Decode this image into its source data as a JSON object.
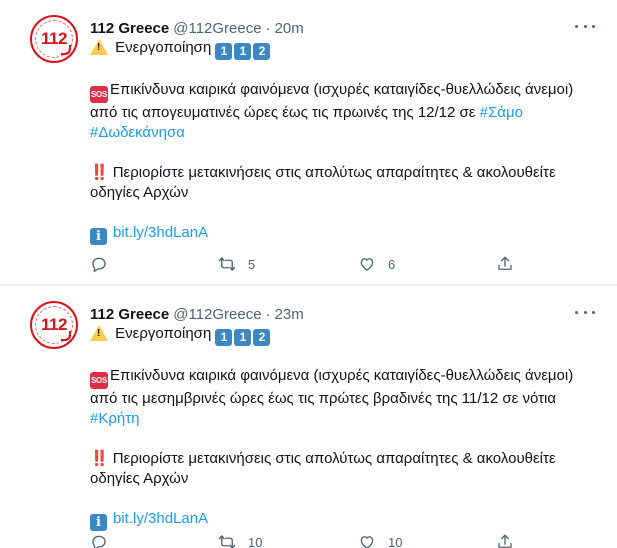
{
  "tweets": [
    {
      "author": "112 Greece",
      "handle": "@112Greece",
      "separator": "·",
      "time": "20m",
      "avatar_text": "112",
      "activation_text": "Ενεργοποίηση",
      "keycaps": [
        "1",
        "1",
        "2"
      ],
      "sos_label": "SOS",
      "warning_line1": "Επικίνδυνα καιρικά φαινόμενα (ισχυρές καταιγίδες-θυελλώδεις άνεμοι)",
      "warning_line2": "από τις απογευματινές ώρες έως τις πρωινές της 12/12 σε",
      "hashtag1": "#Σάμο",
      "hashtag2": "#Δωδεκάνησα",
      "bang": "‼️",
      "advice_line1": "Περιορίστε μετακινήσεις στις απολύτως απαραίτητες & ακολουθείτε",
      "advice_line2": "οδηγίες Αρχών",
      "info_label": "i",
      "link": "bit.ly/3hdLanA",
      "retweets": "5",
      "likes": "6"
    },
    {
      "author": "112 Greece",
      "handle": "@112Greece",
      "separator": "·",
      "time": "23m",
      "avatar_text": "112",
      "activation_text": "Ενεργοποίηση",
      "keycaps": [
        "1",
        "1",
        "2"
      ],
      "sos_label": "SOS",
      "warning_line1": "Επικίνδυνα καιρικά φαινόμενα (ισχυρές καταιγίδες-θυελλώδεις άνεμοι)",
      "warning_line2": "από τις μεσημβρινές ώρες έως τις πρώτες βραδινές της 11/12 σε νότια",
      "hashtag1": "#Κρήτη",
      "bang": "‼️",
      "advice_line1": "Περιορίστε μετακινήσεις στις απολύτως απαραίτητες & ακολουθείτε",
      "advice_line2": "οδηγίες Αρχών",
      "info_label": "i",
      "link": "bit.ly/3hdLanA",
      "retweets": "10",
      "likes": "10"
    }
  ],
  "icons": {
    "more": "more-horizontal-icon",
    "reply": "reply-icon",
    "retweet": "retweet-icon",
    "like": "heart-icon",
    "share": "share-icon"
  },
  "colors": {
    "brand_red": "#d7141a",
    "link_blue": "#1d9bf0",
    "secondary_text": "#536471",
    "keycap_blue": "#3b88c3"
  }
}
